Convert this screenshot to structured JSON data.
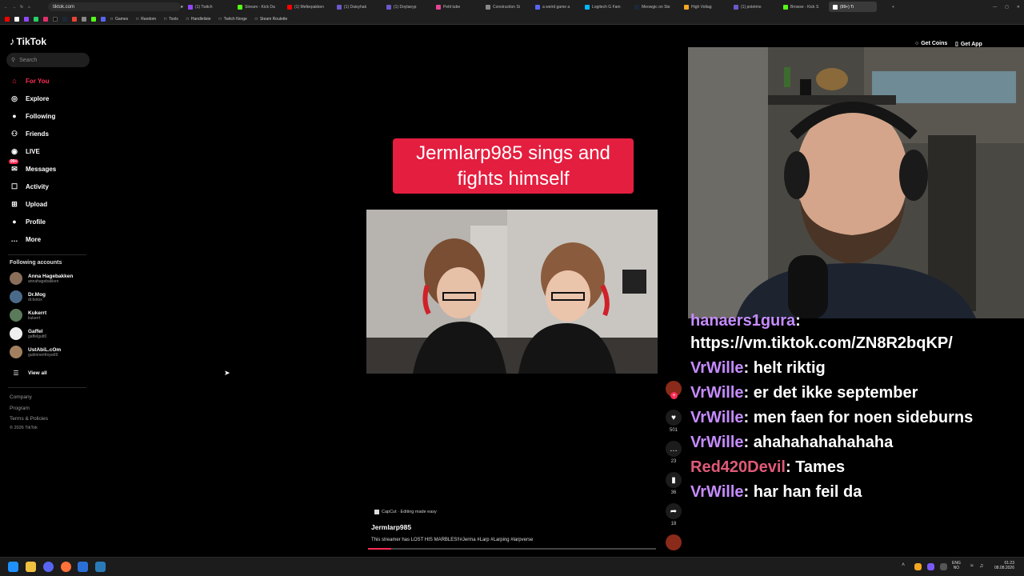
{
  "browser": {
    "url": "tiktok.com",
    "tabs": [
      {
        "label": "(1) Twitch",
        "color": "#9147ff"
      },
      {
        "label": "Stream - Kick Da",
        "color": "#53fc18"
      },
      {
        "label": "(1) Melkepakken",
        "color": "#ff0000"
      },
      {
        "label": "(1) Daisyhak",
        "color": "#6a5acd"
      },
      {
        "label": "(1) Doylaeyp",
        "color": "#6a5acd"
      },
      {
        "label": "Petit tube",
        "color": "#e84393"
      },
      {
        "label": "Construction Si",
        "color": "#888888"
      },
      {
        "label": "a weird game a",
        "color": "#5865f2"
      },
      {
        "label": "Logitech G Fam",
        "color": "#00b8fc"
      },
      {
        "label": "Meowgic on Ste",
        "color": "#1b2838"
      },
      {
        "label": "High Voltag",
        "color": "#f5a623"
      },
      {
        "label": "(1) potetmo",
        "color": "#6a5acd"
      },
      {
        "label": "Browse - Kick S",
        "color": "#53fc18"
      },
      {
        "label": "(99+) Ti",
        "color": "#ffffff"
      }
    ],
    "bookmarks": [
      "Games",
      "Random",
      "Tools",
      "Handleliste",
      "Twitch Norge",
      "Steam Roulette"
    ]
  },
  "sidebar": {
    "logo": "TikTok",
    "search_placeholder": "Search",
    "nav": [
      {
        "label": "For You",
        "icon": "home-icon",
        "active": true
      },
      {
        "label": "Explore",
        "icon": "compass-icon"
      },
      {
        "label": "Following",
        "icon": "following-icon"
      },
      {
        "label": "Friends",
        "icon": "friends-icon"
      },
      {
        "label": "LIVE",
        "icon": "live-icon"
      },
      {
        "label": "Messages",
        "icon": "messages-icon",
        "badge": "99+"
      },
      {
        "label": "Activity",
        "icon": "activity-icon"
      },
      {
        "label": "Upload",
        "icon": "upload-icon"
      },
      {
        "label": "Profile",
        "icon": "profile-icon"
      },
      {
        "label": "More",
        "icon": "more-icon"
      }
    ],
    "following_title": "Following accounts",
    "accounts": [
      {
        "name": "Anna Hagebakken",
        "handle": "annahagebakken",
        "color": "#8a6e5a"
      },
      {
        "name": "Dr.Mog",
        "handle": "dr.botox",
        "color": "#4a6a8a"
      },
      {
        "name": "Kukerrt",
        "handle": "kukerrt",
        "color": "#5a7a5a"
      },
      {
        "name": "Gaffel",
        "handle": "gaffelgutt0",
        "color": "#eeeeee"
      },
      {
        "name": "UstAbiL.cOm",
        "handle": "gudinnenfroya69",
        "color": "#a08060"
      }
    ],
    "view_all": "View all",
    "footer": [
      "Company",
      "Program",
      "Terms & Policies",
      "© 2026 TikTok"
    ]
  },
  "header": {
    "get_coins": "Get Coins",
    "get_app": "Get App"
  },
  "video": {
    "caption": "Jermlarp985 sings and fights himself",
    "capcut": "CapCut · Editing made easy",
    "author": "Jermlarp985",
    "description": "This streamer has LOST HIS MARBLES!!#Jerma #Larp #Larping #larpverse",
    "likes": "501",
    "comments": "23",
    "saves": "36",
    "shares": "18"
  },
  "chat": [
    {
      "user": "hanaers1gura",
      "msg": "",
      "color": "purple",
      "partial": true
    },
    {
      "user": "",
      "msg": "https://vm.tiktok.com/ZN8R2bqKP/",
      "color": "purple"
    },
    {
      "user": "VrWille",
      "msg": "helt riktig",
      "color": "purple"
    },
    {
      "user": "VrWille",
      "msg": "er det ikke september",
      "color": "purple"
    },
    {
      "user": "VrWille",
      "msg": "men faen for noen sideburns",
      "color": "purple"
    },
    {
      "user": "VrWille",
      "msg": "ahahahahahahaha",
      "color": "purple"
    },
    {
      "user": "Red420Devil",
      "msg": "Tames",
      "color": "red"
    },
    {
      "user": "VrWille",
      "msg": "har han feil da",
      "color": "purple"
    }
  ],
  "taskbar": {
    "lang_top": "ENG",
    "lang_bottom": "NO",
    "time": "01:23",
    "date": "08.08.2026"
  },
  "colors": {
    "accent": "#fe2c55",
    "caption_bg": "#e41e3f",
    "chat_purple": "#c58cff",
    "chat_red": "#e05a78"
  }
}
